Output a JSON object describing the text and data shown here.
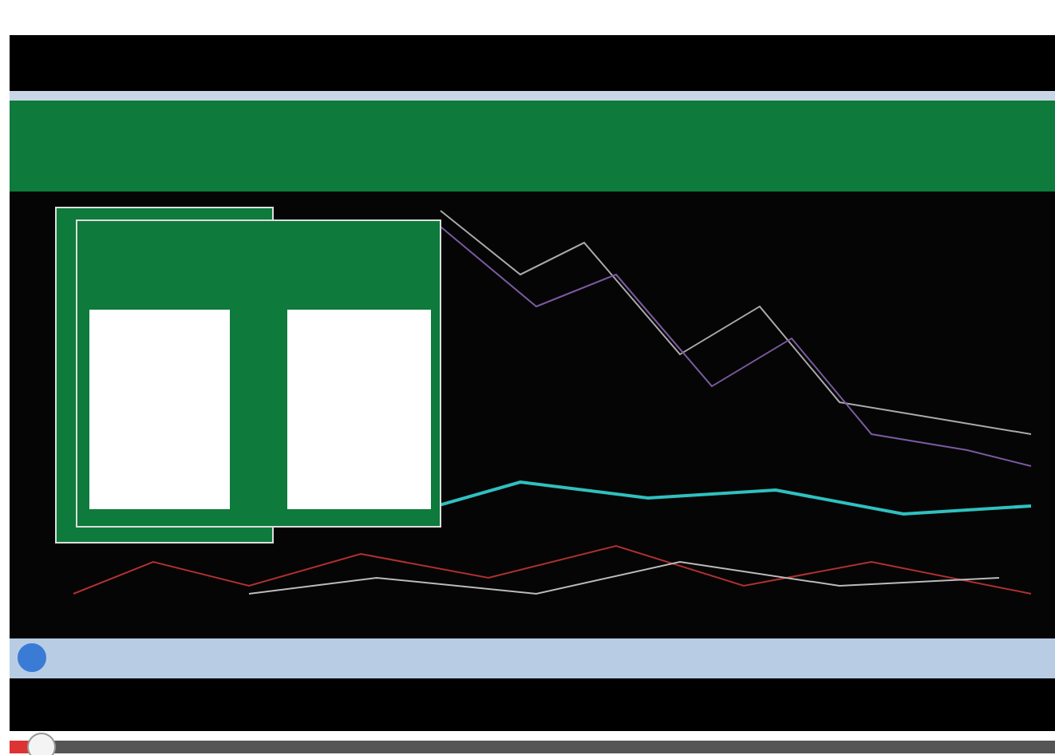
{
  "video_player": {
    "seek_bar": {
      "level": 0.02
    }
  }
}
